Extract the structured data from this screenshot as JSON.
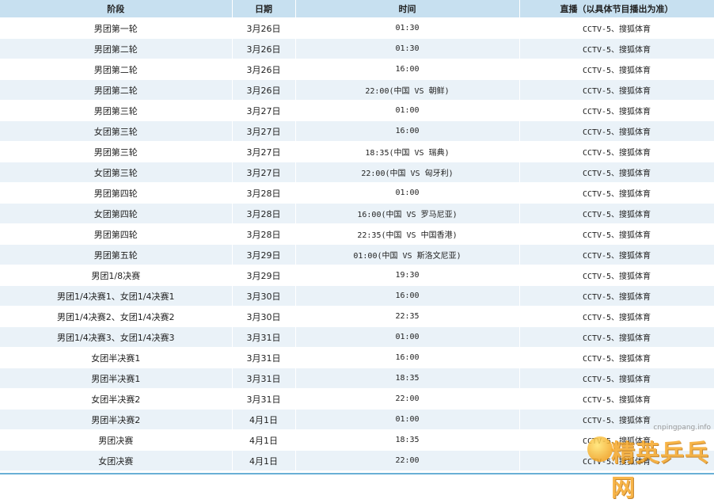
{
  "table": {
    "headers": {
      "stage": "阶段",
      "date": "日期",
      "time": "时间",
      "broadcast": "直播（以具体节目播出为准）"
    },
    "rows": [
      {
        "stage": "男团第一轮",
        "date": "3月26日",
        "time": "01:30",
        "broadcast": "CCTV-5、搜狐体育"
      },
      {
        "stage": "男团第二轮",
        "date": "3月26日",
        "time": "01:30",
        "broadcast": "CCTV-5、搜狐体育"
      },
      {
        "stage": "男团第二轮",
        "date": "3月26日",
        "time": "16:00",
        "broadcast": "CCTV-5、搜狐体育"
      },
      {
        "stage": "男团第二轮",
        "date": "3月26日",
        "time": "22:00(中国 VS 朝鲜)",
        "broadcast": "CCTV-5、搜狐体育"
      },
      {
        "stage": "男团第三轮",
        "date": "3月27日",
        "time": "01:00",
        "broadcast": "CCTV-5、搜狐体育"
      },
      {
        "stage": "女团第三轮",
        "date": "3月27日",
        "time": "16:00",
        "broadcast": "CCTV-5、搜狐体育"
      },
      {
        "stage": "男团第三轮",
        "date": "3月27日",
        "time": "18:35(中国 VS 瑞典)",
        "broadcast": "CCTV-5、搜狐体育"
      },
      {
        "stage": "女团第三轮",
        "date": "3月27日",
        "time": "22:00(中国 VS 匈牙利)",
        "broadcast": "CCTV-5、搜狐体育"
      },
      {
        "stage": "男团第四轮",
        "date": "3月28日",
        "time": "01:00",
        "broadcast": "CCTV-5、搜狐体育"
      },
      {
        "stage": "女团第四轮",
        "date": "3月28日",
        "time": "16:00(中国 VS 罗马尼亚)",
        "broadcast": "CCTV-5、搜狐体育"
      },
      {
        "stage": "男团第四轮",
        "date": "3月28日",
        "time": "22:35(中国 VS 中国香港)",
        "broadcast": "CCTV-5、搜狐体育"
      },
      {
        "stage": "男团第五轮",
        "date": "3月29日",
        "time": "01:00(中国 VS 斯洛文尼亚)",
        "broadcast": "CCTV-5、搜狐体育"
      },
      {
        "stage": "男团1/8决赛",
        "date": "3月29日",
        "time": "19:30",
        "broadcast": "CCTV-5、搜狐体育"
      },
      {
        "stage": "男团1/4决赛1、女团1/4决赛1",
        "date": "3月30日",
        "time": "16:00",
        "broadcast": "CCTV-5、搜狐体育"
      },
      {
        "stage": "男团1/4决赛2、女团1/4决赛2",
        "date": "3月30日",
        "time": "22:35",
        "broadcast": "CCTV-5、搜狐体育"
      },
      {
        "stage": "男团1/4决赛3、女团1/4决赛3",
        "date": "3月31日",
        "time": "01:00",
        "broadcast": "CCTV-5、搜狐体育"
      },
      {
        "stage": "女团半决赛1",
        "date": "3月31日",
        "time": "16:00",
        "broadcast": "CCTV-5、搜狐体育"
      },
      {
        "stage": "男团半决赛1",
        "date": "3月31日",
        "time": "18:35",
        "broadcast": "CCTV-5、搜狐体育"
      },
      {
        "stage": "女团半决赛2",
        "date": "3月31日",
        "time": "22:00",
        "broadcast": "CCTV-5、搜狐体育"
      },
      {
        "stage": "男团半决赛2",
        "date": "4月1日",
        "time": "01:00",
        "broadcast": "CCTV-5、搜狐体育"
      },
      {
        "stage": "男团决赛",
        "date": "4月1日",
        "time": "18:35",
        "broadcast": "CCTV-5、搜狐体育"
      },
      {
        "stage": "女团决赛",
        "date": "4月1日",
        "time": "22:00",
        "broadcast": "CCTV-5、搜狐体育"
      }
    ]
  },
  "watermark": {
    "domain": "cnpingpang.info",
    "name": "精英乒乓网",
    "icon": "ping-pong-ball-icon",
    "color": "#f6a21a"
  },
  "colors": {
    "header_bg": "#c7e0f0",
    "row_alt_bg": "#eaf2f8",
    "accent": "#6ab0d6"
  }
}
